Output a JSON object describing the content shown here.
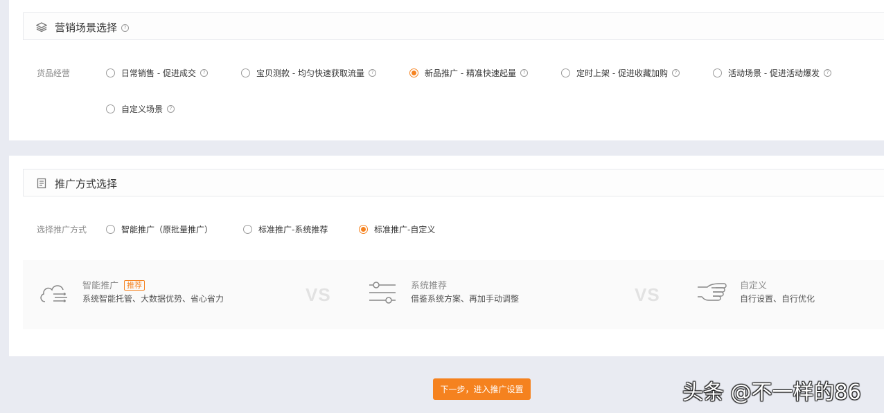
{
  "scene_section": {
    "title": "营销场景选择",
    "row_label": "货品经营",
    "options": [
      {
        "label": "日常销售 - 促进成交",
        "checked": false
      },
      {
        "label": "宝贝测款 - 均匀快速获取流量",
        "checked": false
      },
      {
        "label": "新品推广 - 精准快速起量",
        "checked": true
      },
      {
        "label": "定时上架 - 促进收藏加购",
        "checked": false
      },
      {
        "label": "活动场景 - 促进活动爆发",
        "checked": false
      },
      {
        "label": "自定义场景",
        "checked": false
      }
    ]
  },
  "method_section": {
    "title": "推广方式选择",
    "row_label": "选择推广方式",
    "options": [
      {
        "label": "智能推广（原批量推广）",
        "checked": false
      },
      {
        "label": "标准推广-系统推荐",
        "checked": false
      },
      {
        "label": "标准推广-自定义",
        "checked": true
      }
    ]
  },
  "compare": {
    "items": [
      {
        "icon": "cloud-hand-icon",
        "title": "智能推广",
        "badge": "推荐",
        "desc": "系统智能托管、大数据优势、省心省力"
      },
      {
        "icon": "sliders-icon",
        "title": "系统推荐",
        "desc": "借鉴系统方案、再加手动调整"
      },
      {
        "icon": "pointing-hand-icon",
        "title": "自定义",
        "desc": "自行设置、自行优化"
      }
    ],
    "vs_label": "VS"
  },
  "next_button": {
    "label": "下一步，进入推广设置"
  },
  "help_mark": "?",
  "watermark": {
    "text": "头条 @不一样的86"
  },
  "colors": {
    "accent": "#f5821f",
    "page_bg": "#e9ebf2",
    "panel_bg": "#ffffff"
  }
}
